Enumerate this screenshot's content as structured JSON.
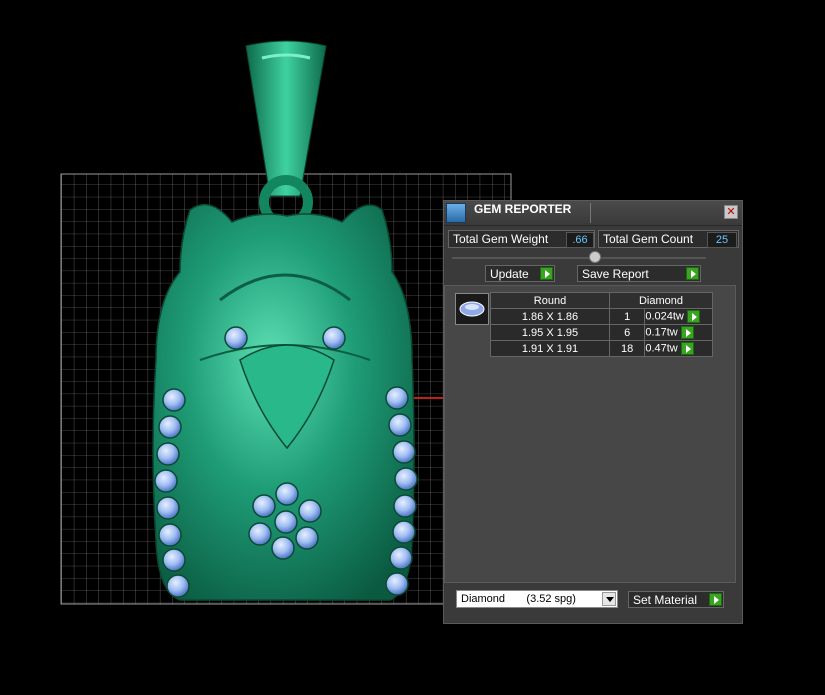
{
  "panel": {
    "title": "GEM REPORTER",
    "close": "✕",
    "total_gem_weight_label": "Total Gem Weight",
    "total_gem_weight": ".66",
    "total_gem_count_label": "Total Gem Count",
    "total_gem_count": "25",
    "update_label": "Update",
    "save_report_label": "Save Report",
    "table": {
      "headers": [
        "Round",
        "Diamond"
      ],
      "rows": [
        {
          "size": "1.86 X 1.86",
          "count": "1",
          "weight": "0.024tw"
        },
        {
          "size": "1.95 X 1.95",
          "count": "6",
          "weight": "0.17tw"
        },
        {
          "size": "1.91 X 1.91",
          "count": "18",
          "weight": "0.47tw"
        }
      ]
    },
    "material": "Diamond       (3.52 spg)",
    "set_material_label": "Set Material"
  },
  "colors": {
    "metal": "#1f9e78",
    "gem": "#9fbdf2",
    "accent_green": "#3aa322",
    "value_blue": "#6cc4ff"
  }
}
